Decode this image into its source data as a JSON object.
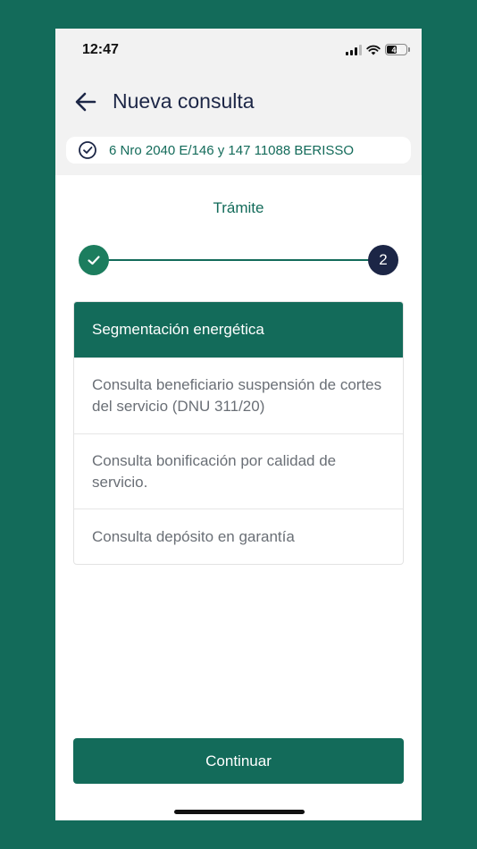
{
  "status_bar": {
    "time": "12:47",
    "battery_level": "46"
  },
  "header": {
    "title": "Nueva consulta"
  },
  "address": {
    "text": "6 Nro 2040 E/146 y 147 11088 BERISSO"
  },
  "stepper": {
    "label": "Trámite",
    "current_step": "2"
  },
  "options": [
    {
      "label": "Segmentación energética",
      "selected": true
    },
    {
      "label": "Consulta beneficiario suspensión de cortes del servicio (DNU 311/20)",
      "selected": false
    },
    {
      "label": "Consulta bonificación por calidad de servicio.",
      "selected": false
    },
    {
      "label": "Consulta depósito en garantía",
      "selected": false
    }
  ],
  "actions": {
    "continue_label": "Continuar"
  },
  "colors": {
    "primary_green": "#136b5a",
    "navy": "#1c2646",
    "check_green": "#1c7d5e"
  }
}
